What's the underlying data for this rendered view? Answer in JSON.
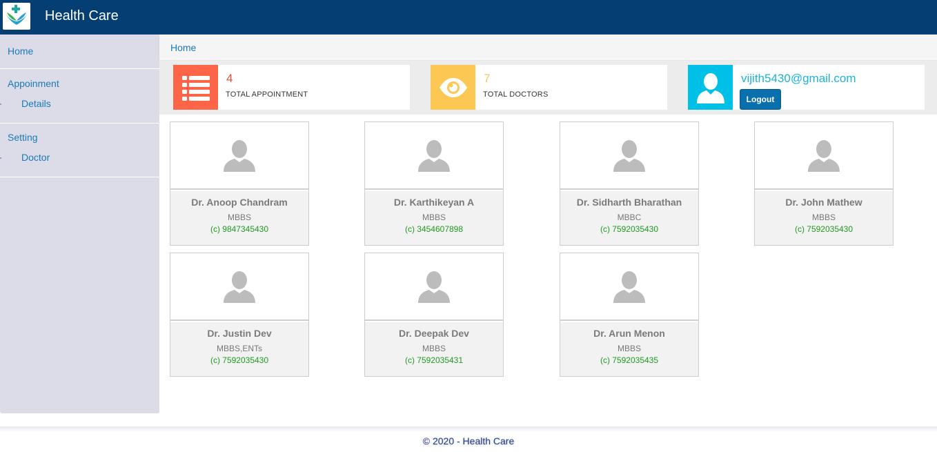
{
  "header": {
    "app_title": "Health Care",
    "logo_icon": "caring-hands-plus-icon"
  },
  "sidebar": {
    "items": [
      {
        "label": "Home"
      },
      {
        "label": "Appoinment",
        "children": [
          {
            "label": "Details"
          }
        ]
      },
      {
        "label": "Setting",
        "children": [
          {
            "label": "Doctor"
          }
        ]
      }
    ]
  },
  "breadcrumb": {
    "label": "Home"
  },
  "stats": [
    {
      "value": "4",
      "label": "TOTAL APPOINTMENT",
      "icon": "list-icon",
      "color": "#fc6548",
      "value_color": "#e74c3c"
    },
    {
      "value": "7",
      "label": "TOTAL DOCTORS",
      "icon": "eye-icon",
      "color": "#fdc753",
      "value_color": "#f5c46a"
    }
  ],
  "user": {
    "email": "vijith5430@gmail.com",
    "logout_label": "Logout",
    "icon": "user-icon",
    "color": "#00c0e8"
  },
  "doctors": [
    {
      "name": "Dr. Anoop Chandram",
      "qualification": "MBBS",
      "phone": "(c) 9847345430"
    },
    {
      "name": "Dr. Karthikeyan A",
      "qualification": "MBBS",
      "phone": "(c) 3454607898"
    },
    {
      "name": "Dr. Sidharth Bharathan",
      "qualification": "MBBC",
      "phone": "(c) 7592035430"
    },
    {
      "name": "Dr. John Mathew",
      "qualification": "MBBS",
      "phone": "(c) 7592035430"
    },
    {
      "name": "Dr. Justin Dev",
      "qualification": "MBBS,ENTs",
      "phone": "(c) 7592035430"
    },
    {
      "name": "Dr. Deepak Dev",
      "qualification": "MBBS",
      "phone": "(c) 7592035431"
    },
    {
      "name": "Dr. Arun Menon",
      "qualification": "MBBS",
      "phone": "(c) 7592035435"
    }
  ],
  "footer": {
    "text": "© 2020 - Health Care"
  },
  "colors": {
    "header": "#053e72",
    "sidebar": "#dcdbe8",
    "link": "#1a7ab8"
  }
}
